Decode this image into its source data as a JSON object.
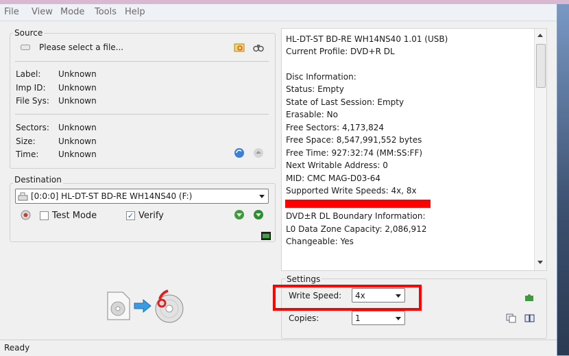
{
  "menu": [
    "File",
    "View",
    "Mode",
    "Tools",
    "Help"
  ],
  "source": {
    "legend": "Source",
    "file_placeholder": "Please select a file...",
    "labels": {
      "label": "Label:",
      "imp_id": "Imp ID:",
      "file_sys": "File Sys:",
      "sectors": "Sectors:",
      "size": "Size:",
      "time": "Time:"
    },
    "values": {
      "label": "Unknown",
      "imp_id": "Unknown",
      "file_sys": "Unknown",
      "sectors": "Unknown",
      "size": "Unknown",
      "time": "Unknown"
    }
  },
  "destination": {
    "legend": "Destination",
    "drive": "[0:0:0] HL-DT-ST BD-RE  WH14NS40 (F:)",
    "test_mode": "Test Mode",
    "verify": "Verify",
    "verify_checked": true,
    "test_mode_checked": false
  },
  "info": {
    "lines": [
      "HL-DT-ST BD-RE  WH14NS40 1.01 (USB)",
      "Current Profile: DVD+R DL",
      "",
      "Disc Information:",
      "Status: Empty",
      "State of Last Session: Empty",
      "Erasable: No",
      "Free Sectors: 4,173,824",
      "Free Space: 8,547,991,552 bytes",
      "Free Time: 927:32:74 (MM:SS:FF)",
      "Next Writable Address: 0",
      "MID: CMC MAG-D03-64",
      "Supported Write Speeds: 4x, 8x",
      "",
      "DVD±R DL Boundary Information:",
      "L0 Data Zone Capacity: 2,086,912",
      "Changeable: Yes"
    ]
  },
  "settings": {
    "legend": "Settings",
    "write_speed_label": "Write Speed:",
    "write_speed_value": "4x",
    "copies_label": "Copies:",
    "copies_value": "1"
  },
  "status": "Ready",
  "colors": {
    "highlight": "#ff0000"
  }
}
